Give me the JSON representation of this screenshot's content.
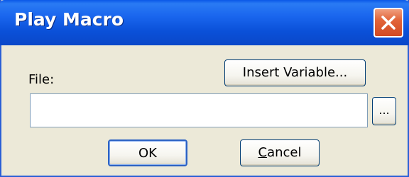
{
  "window": {
    "title": "Play Macro"
  },
  "form": {
    "file_label": "File:",
    "file_value": "",
    "file_placeholder": ""
  },
  "buttons": {
    "insert_variable": "Insert Variable...",
    "browse": "...",
    "ok": "OK",
    "cancel_first": "C",
    "cancel_rest": "ancel"
  },
  "icons": {
    "close": "close-icon"
  },
  "colors": {
    "titlebar": "#0a50d8",
    "close_button": "#e2653a",
    "dialog_background": "#ece9d8",
    "button_border": "#003c74"
  }
}
